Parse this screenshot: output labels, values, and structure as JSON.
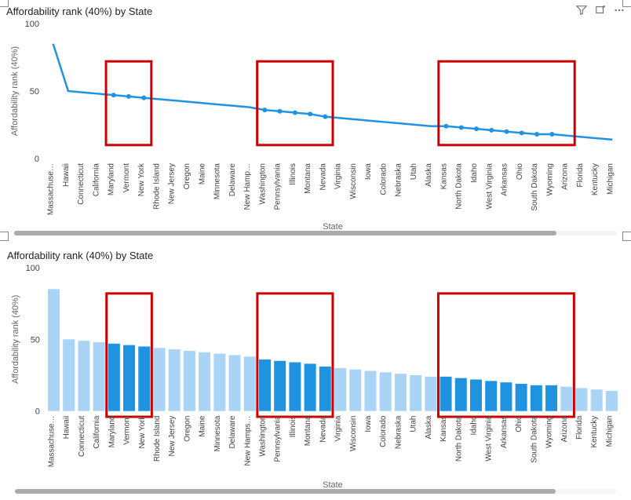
{
  "visual1": {
    "title": "Affordability rank (40%) by State",
    "yLabel": "Affordability rank (40%)",
    "xLabel": "State",
    "yTicks": [
      0,
      50,
      100
    ],
    "highlightBoxes": [
      {
        "startIndex": 4,
        "endIndex": 6
      },
      {
        "startIndex": 14,
        "endIndex": 18
      },
      {
        "startIndex": 26,
        "endIndex": 34
      }
    ]
  },
  "visual2": {
    "title": "Affordability rank (40%) by State",
    "yLabel": "Affordability rank (40%)",
    "xLabel": "State",
    "yTicks": [
      0,
      50,
      100
    ],
    "barColorLight": "#a9d4f5",
    "barColorDark": "#1f93e0",
    "highlightBoxes": [
      {
        "startIndex": 4,
        "endIndex": 6
      },
      {
        "startIndex": 14,
        "endIndex": 18
      },
      {
        "startIndex": 26,
        "endIndex": 34
      }
    ]
  },
  "chart_data": [
    {
      "type": "line",
      "title": "Affordability rank (40%) by State",
      "xlabel": "State",
      "ylabel": "Affordability rank (40%)",
      "ylim": [
        0,
        100
      ],
      "categories": [
        "Massachuse…",
        "Hawaii",
        "Connecticut",
        "California",
        "Maryland",
        "Vermont",
        "New York",
        "Rhode Island",
        "New Jersey",
        "Oregon",
        "Maine",
        "Minnesota",
        "Delaware",
        "New Hamp…",
        "Washington",
        "Pennsylvania",
        "Illinois",
        "Montana",
        "Nevada",
        "Virginia",
        "Wisconsin",
        "Iowa",
        "Colorado",
        "Nebraska",
        "Utah",
        "Alaska",
        "Kansas",
        "North Dakota",
        "Idaho",
        "West Virginia",
        "Arkansas",
        "Ohio",
        "South Dakota",
        "Wyoming",
        "Arizona",
        "Florida",
        "Kentucky",
        "Michigan"
      ],
      "values": [
        85,
        50,
        49,
        48,
        47,
        46,
        45,
        44,
        43,
        42,
        41,
        40,
        39,
        38,
        36,
        35,
        34,
        33,
        31,
        30,
        29,
        28,
        27,
        26,
        25,
        24,
        24,
        23,
        22,
        21,
        20,
        19,
        18,
        18,
        17,
        16,
        15,
        14
      ],
      "highlighted_categories": [
        "Maryland",
        "Vermont",
        "New York",
        "Washington",
        "Pennsylvania",
        "Illinois",
        "Montana",
        "Nevada",
        "Kansas",
        "North Dakota",
        "Idaho",
        "West Virginia",
        "Arkansas",
        "Ohio",
        "South Dakota",
        "Wyoming"
      ]
    },
    {
      "type": "bar",
      "title": "Affordability rank (40%) by State",
      "xlabel": "State",
      "ylabel": "Affordability rank (40%)",
      "ylim": [
        0,
        100
      ],
      "categories": [
        "Massachuse…",
        "Hawaii",
        "Connecticut",
        "California",
        "Maryland",
        "Vermont",
        "New York",
        "Rhode Island",
        "New Jersey",
        "Oregon",
        "Maine",
        "Minnesota",
        "Delaware",
        "New Hamps…",
        "Washington",
        "Pennsylvania",
        "Illinois",
        "Montana",
        "Nevada",
        "Virginia",
        "Wisconsin",
        "Iowa",
        "Colorado",
        "Nebraska",
        "Utah",
        "Alaska",
        "Kansas",
        "North Dakota",
        "Idaho",
        "West Virginia",
        "Arkansas",
        "Ohio",
        "South Dakota",
        "Wyoming",
        "Arizona",
        "Florida",
        "Kentucky",
        "Michigan"
      ],
      "values": [
        85,
        50,
        49,
        48,
        47,
        46,
        45,
        44,
        43,
        42,
        41,
        40,
        39,
        38,
        36,
        35,
        34,
        33,
        31,
        30,
        29,
        28,
        27,
        26,
        25,
        24,
        24,
        23,
        22,
        21,
        20,
        19,
        18,
        18,
        17,
        16,
        15,
        14
      ],
      "highlighted_categories": [
        "Maryland",
        "Vermont",
        "New York",
        "Washington",
        "Pennsylvania",
        "Illinois",
        "Montana",
        "Nevada",
        "Kansas",
        "North Dakota",
        "Idaho",
        "West Virginia",
        "Arkansas",
        "Ohio",
        "South Dakota",
        "Wyoming"
      ]
    }
  ]
}
